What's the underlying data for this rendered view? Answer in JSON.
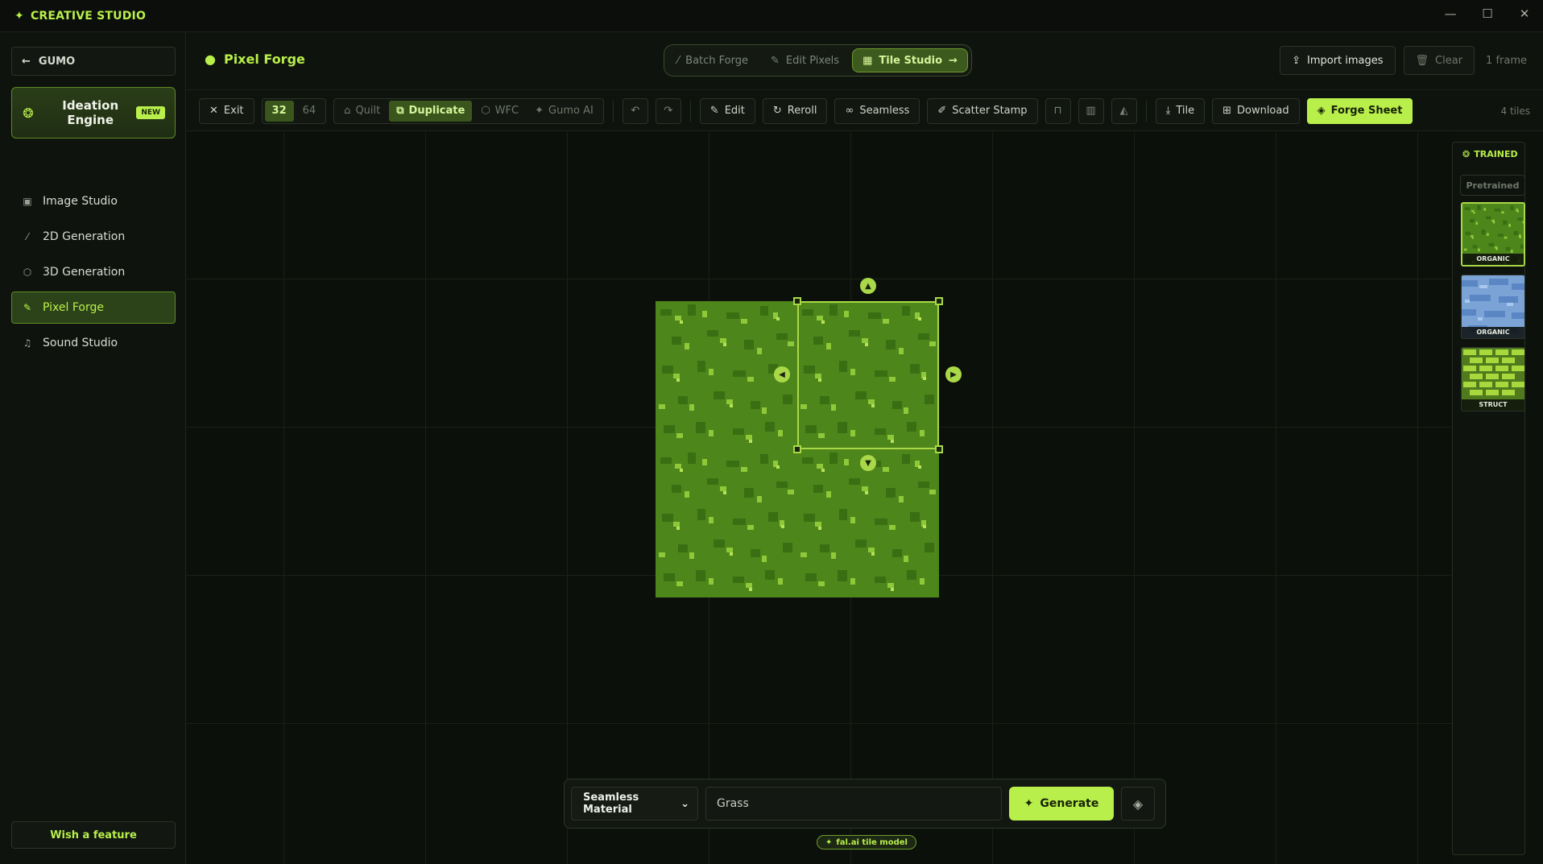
{
  "titlebar": {
    "app_name": "CREATIVE STUDIO",
    "min_icon": "minimize-icon",
    "max_icon": "maximize-icon",
    "close_icon": "close-icon"
  },
  "sidebar": {
    "back_label": "GUMO",
    "ideation": {
      "label_line1": "Ideation",
      "label_line2": "Engine",
      "badge": "NEW"
    },
    "items": [
      {
        "label": "Image Studio",
        "icon": "image-icon",
        "active": false
      },
      {
        "label": "2D Generation",
        "icon": "wand-icon",
        "active": false
      },
      {
        "label": "3D Generation",
        "icon": "cube-icon",
        "active": false
      },
      {
        "label": "Pixel Forge",
        "icon": "pencil-icon",
        "active": true
      },
      {
        "label": "Sound Studio",
        "icon": "music-icon",
        "active": false
      }
    ],
    "wish_label": "Wish a feature"
  },
  "header": {
    "title": "Pixel Forge",
    "modes": [
      {
        "label": "Batch Forge",
        "active": false
      },
      {
        "label": "Edit Pixels",
        "active": false
      },
      {
        "label": "Tile Studio",
        "active": true
      }
    ],
    "import_label": "Import images",
    "clear_label": "Clear",
    "frame_count": "1 frame"
  },
  "toolbar": {
    "exit_label": "Exit",
    "size_32": "32",
    "size_64": "64",
    "modes": [
      "Quilt",
      "Duplicate",
      "WFC",
      "Gumo AI"
    ],
    "active_mode": "Duplicate",
    "edit_label": "Edit",
    "reroll_label": "Reroll",
    "seamless_label": "Seamless",
    "scatter_label": "Scatter Stamp",
    "tile_label": "Tile",
    "download_label": "Download",
    "forge_label": "Forge Sheet",
    "tile_count": "4 tiles"
  },
  "prompt": {
    "type": "Seamless Material",
    "value": "Grass",
    "generate_label": "Generate",
    "model_badge": "fal.ai tile model"
  },
  "right_panel": {
    "trained_label": "TRAINED",
    "pretrained_label": "Pretrained",
    "thumbs": [
      {
        "label": "ORGANIC",
        "kind": "grass"
      },
      {
        "label": "ORGANIC",
        "kind": "water"
      },
      {
        "label": "STRUCT",
        "kind": "brick"
      }
    ]
  },
  "colors": {
    "accent": "#b8ef4a",
    "background": "#0d110c",
    "grass": "#4f8a1c"
  }
}
